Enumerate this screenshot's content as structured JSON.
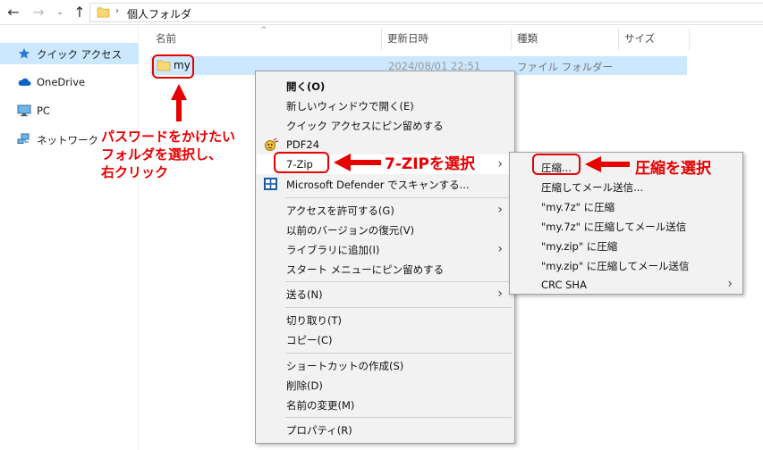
{
  "addressbar": {
    "back": "←",
    "forward": "→",
    "history": "⌄",
    "up": "↑",
    "separator": "›",
    "path": "個人フォルダ"
  },
  "navpane": {
    "items": [
      {
        "label": "クイック アクセス",
        "icon": "star-icon",
        "selected": true
      },
      {
        "label": "OneDrive",
        "icon": "cloud-icon"
      },
      {
        "label": "PC",
        "icon": "monitor-icon"
      },
      {
        "label": "ネットワーク",
        "icon": "network-icon"
      }
    ]
  },
  "filelist": {
    "columns": [
      "名前",
      "更新日時",
      "種類",
      "サイズ"
    ],
    "sort_indicator": "^",
    "rows": [
      {
        "name": "my",
        "date": "2024/08/01 22:51",
        "type": "ファイル フォルダー"
      }
    ]
  },
  "context_menu": {
    "items": [
      {
        "label": "開く(O)",
        "bold": true
      },
      {
        "label": "新しいウィンドウで開く(E)"
      },
      {
        "label": "クイック アクセスにピン留めする"
      },
      {
        "label": "PDF24",
        "icon": "pdf24-icon"
      },
      {
        "label": "7-Zip",
        "submenu": true
      },
      {
        "label": "Microsoft Defender でスキャンする...",
        "icon": "defender-icon"
      },
      {
        "label": "アクセスを許可する(G)",
        "submenu": true
      },
      {
        "label": "以前のバージョンの復元(V)"
      },
      {
        "label": "ライブラリに追加(I)",
        "submenu": true
      },
      {
        "label": "スタート メニューにピン留めする"
      },
      {
        "label": "送る(N)",
        "submenu": true
      },
      {
        "label": "切り取り(T)"
      },
      {
        "label": "コピー(C)"
      },
      {
        "label": "ショートカットの作成(S)"
      },
      {
        "label": "削除(D)"
      },
      {
        "label": "名前の変更(M)"
      },
      {
        "label": "プロパティ(R)"
      }
    ]
  },
  "submenu": {
    "items": [
      {
        "label": "圧縮..."
      },
      {
        "label": "圧縮してメール送信..."
      },
      {
        "label": "\"my.7z\" に圧縮"
      },
      {
        "label": "\"my.7z\" に圧縮してメール送信"
      },
      {
        "label": "\"my.zip\" に圧縮"
      },
      {
        "label": "\"my.zip\" に圧縮してメール送信"
      },
      {
        "label": "CRC SHA",
        "submenu": true
      }
    ]
  },
  "annotations": {
    "step1": [
      "パスワードをかけたい",
      "フォルダを選択し、",
      "右クリック"
    ],
    "step2": "7-ZIPを選択",
    "step3": "圧縮を選択",
    "color": "#e60000"
  },
  "colors": {
    "selection": "#cce8ff",
    "menu_bg": "#f2f2f2",
    "folder": "#f8d775"
  }
}
